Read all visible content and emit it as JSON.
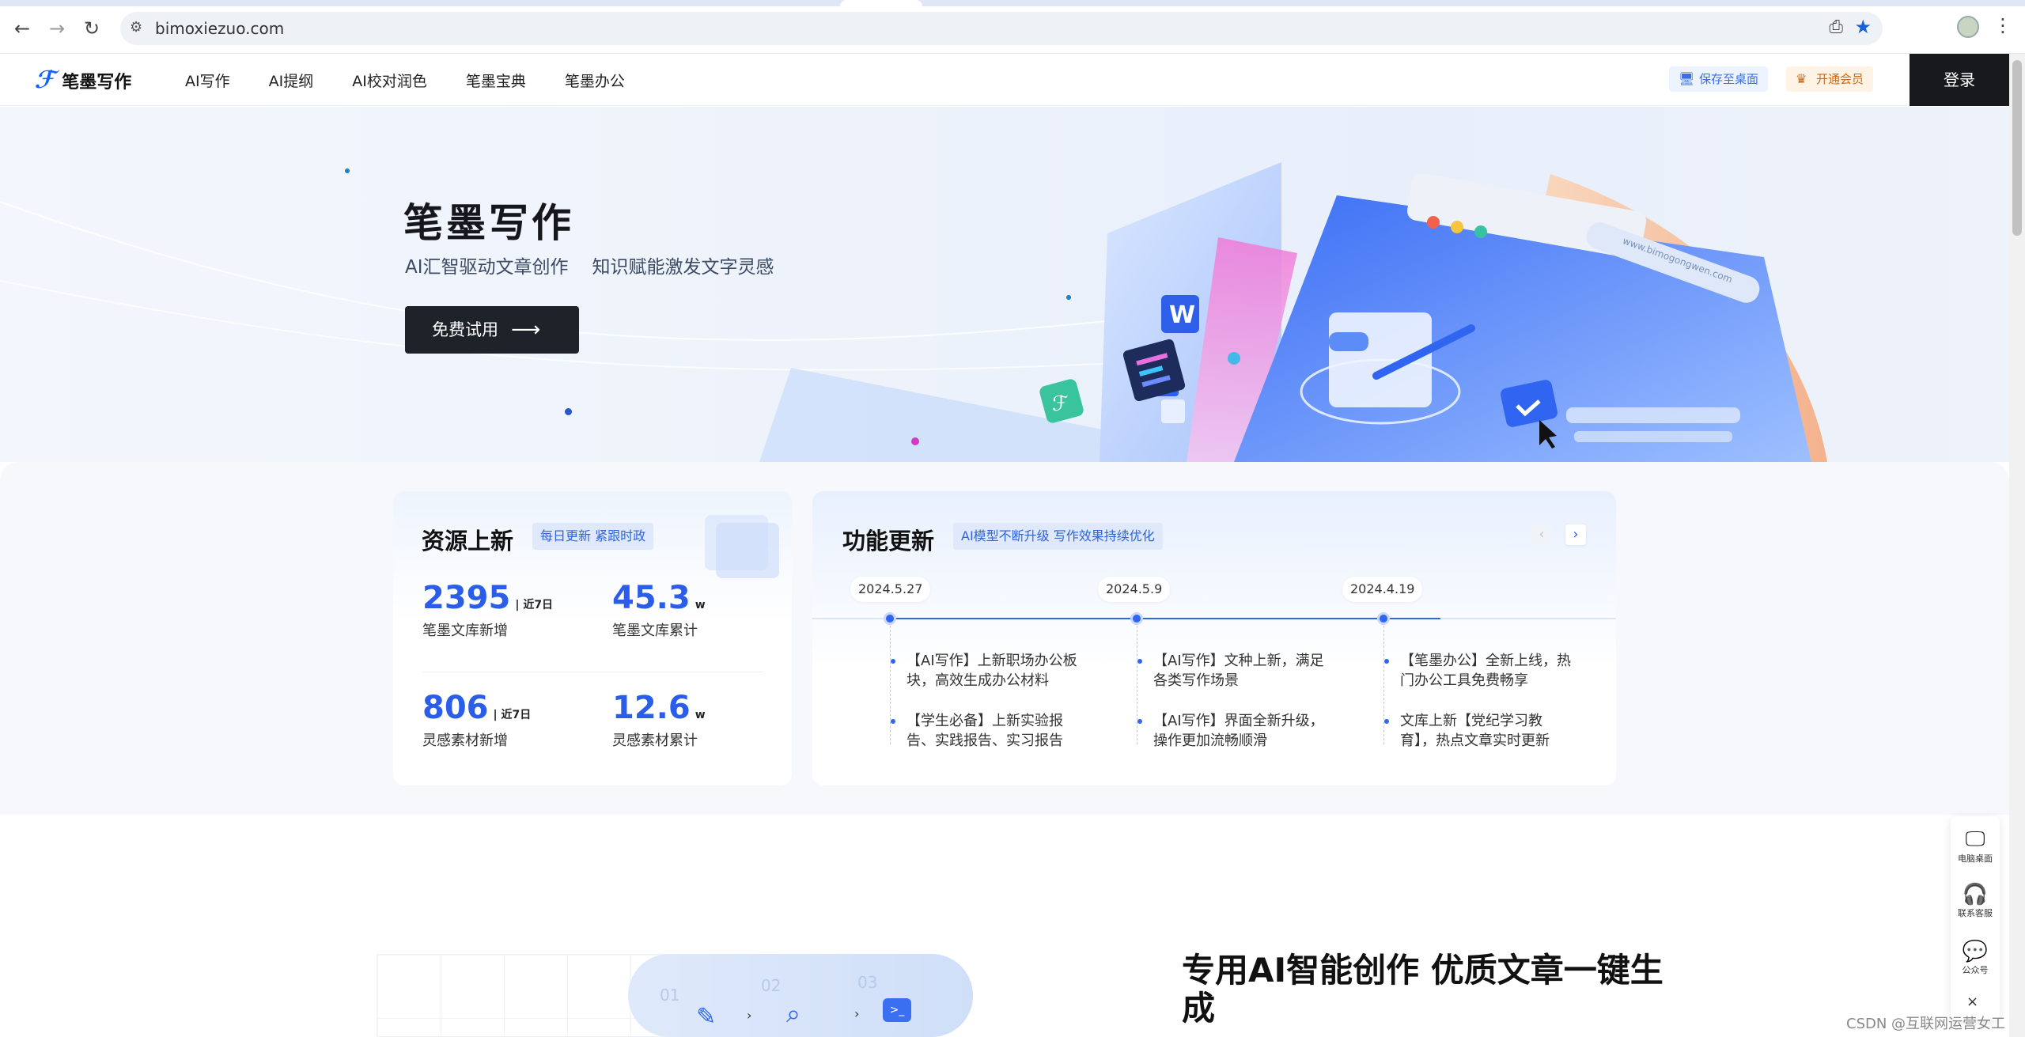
{
  "browser": {
    "url": "bimoxiezuo.com"
  },
  "header": {
    "logo_text": "笔墨写作",
    "menu": [
      "AI写作",
      "AI提纲",
      "AI校对润色",
      "笔墨宝典",
      "笔墨办公"
    ],
    "save_desktop": "保存至桌面",
    "vip": "开通会员",
    "login": "登录"
  },
  "hero": {
    "title": "笔墨写作",
    "subtitle_1": "AI汇智驱动文章创作",
    "subtitle_2": "知识赋能激发文字灵感",
    "cta": "免费试用",
    "illustration": {
      "w_badge": "W",
      "url_text": "www.bimogongwen.com"
    }
  },
  "resources": {
    "title": "资源上新",
    "tag": "每日更新 紧跟时政",
    "stats": [
      {
        "value": "2395",
        "unit": "| 近7日",
        "label": "笔墨文库新增"
      },
      {
        "value": "45.3",
        "unit": "w",
        "label": "笔墨文库累计"
      },
      {
        "value": "806",
        "unit": "| 近7日",
        "label": "灵感素材新增"
      },
      {
        "value": "12.6",
        "unit": "w",
        "label": "灵感素材累计"
      }
    ]
  },
  "features": {
    "title": "功能更新",
    "tag": "AI模型不断升级 写作效果持续优化",
    "timeline": [
      {
        "date": "2024.5.27",
        "items": [
          "【AI写作】上新职场办公板块，高效生成办公材料",
          "【学生必备】上新实验报告、实践报告、实习报告"
        ]
      },
      {
        "date": "2024.5.9",
        "items": [
          "【AI写作】文种上新，满足各类写作场景",
          "【AI写作】界面全新升级，操作更加流畅顺滑"
        ]
      },
      {
        "date": "2024.4.19",
        "items": [
          "【笔墨办公】全新上线，热门办公工具免费畅享",
          "文库上新【党纪学习教育】，热点文章实时更新"
        ]
      }
    ]
  },
  "lower": {
    "title": "专用AI智能创作 优质文章一键生成",
    "steps": [
      "01",
      "02",
      "03"
    ]
  },
  "sidebar": {
    "items": [
      "电脑桌面",
      "联系客服",
      "公众号"
    ]
  },
  "watermark": "CSDN @互联网运营女工"
}
